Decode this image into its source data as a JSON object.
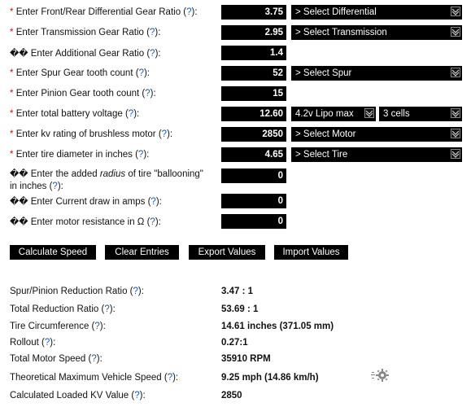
{
  "inputs": [
    {
      "marker": "*",
      "label": "Enter Front/Rear Differential Gear Ratio",
      "q": "?",
      "suffix": "):",
      "value": "3.75",
      "select1": "> Select Differential"
    },
    {
      "marker": "*",
      "label": "Enter Transmission Gear Ratio",
      "q": "?",
      "suffix": "):",
      "value": "2.95",
      "select1": "> Select Transmission"
    },
    {
      "marker": "��",
      "label": "Enter Additional Gear Ratio",
      "q": "?",
      "suffix": "):",
      "value": "1.4"
    },
    {
      "marker": "*",
      "label": "Enter Spur Gear tooth count",
      "q": "?",
      "suffix": "):",
      "value": "52",
      "select1": "> Select Spur"
    },
    {
      "marker": "*",
      "label": "Enter Pinion Gear tooth count",
      "q": "?",
      "suffix": "):",
      "value": "15"
    },
    {
      "marker": "*",
      "label": "Enter total battery voltage",
      "q": "?",
      "suffix": "):",
      "value": "12.60",
      "select1": "4.2v Lipo max",
      "select2": "3 cells"
    },
    {
      "marker": "*",
      "label": "Enter kv rating of brushless motor",
      "q": "?",
      "suffix": "):",
      "value": "2850",
      "select1": "> Select Motor"
    },
    {
      "marker": "*",
      "label": "Enter tire diameter in inches",
      "q": "?",
      "suffix": "):",
      "value": "4.65",
      "select1": "> Select Tire"
    },
    {
      "marker": "��",
      "label_a": "Enter the added ",
      "label_em": "radius",
      "label_b": " of tire \"ballooning\" in inches",
      "q": "?",
      "suffix": "):",
      "value": "0"
    },
    {
      "marker": "��",
      "label": "Enter Current draw in amps",
      "q": "?",
      "suffix": "):",
      "value": "0"
    },
    {
      "marker": "��",
      "label": "Enter motor resistance in Ω",
      "q": "?",
      "suffix": "):",
      "value": "0"
    }
  ],
  "buttons": {
    "calculate": "Calculate Speed",
    "clear": "Clear Entries",
    "export": "Export Values",
    "import": "Import Values"
  },
  "results": [
    {
      "label": "Spur/Pinion Reduction Ratio",
      "q": "?",
      "suffix": "):",
      "value": "3.47 : 1"
    },
    {
      "label": "Total Reduction Ratio",
      "q": "?",
      "suffix": "):",
      "value": "53.69 : 1"
    },
    {
      "label": "Tire Circumference",
      "q": "?",
      "suffix": "):",
      "value": "14.61 inches (371.05 mm)"
    },
    {
      "label": "Rollout",
      "q": "?",
      "suffix": "):",
      "value": "0.27:1"
    },
    {
      "label": "Total Motor Speed",
      "q": "?",
      "suffix": "):",
      "value": "35910 RPM"
    },
    {
      "label": "Theoretical Maximum Vehicle Speed",
      "q": "?",
      "suffix": "):",
      "value": "9.25 mph (14.86 km/h)"
    },
    {
      "label": "Calculated Loaded KV Value",
      "q": "?",
      "suffix": "):",
      "value": "2850"
    }
  ],
  "icons": {
    "gear": "gear-icon",
    "dropdown": "chevron-down-icon"
  },
  "colors": {
    "required_marker": "#cc1111",
    "help_link": "#1a5fb4",
    "control_bg": "#000000"
  }
}
